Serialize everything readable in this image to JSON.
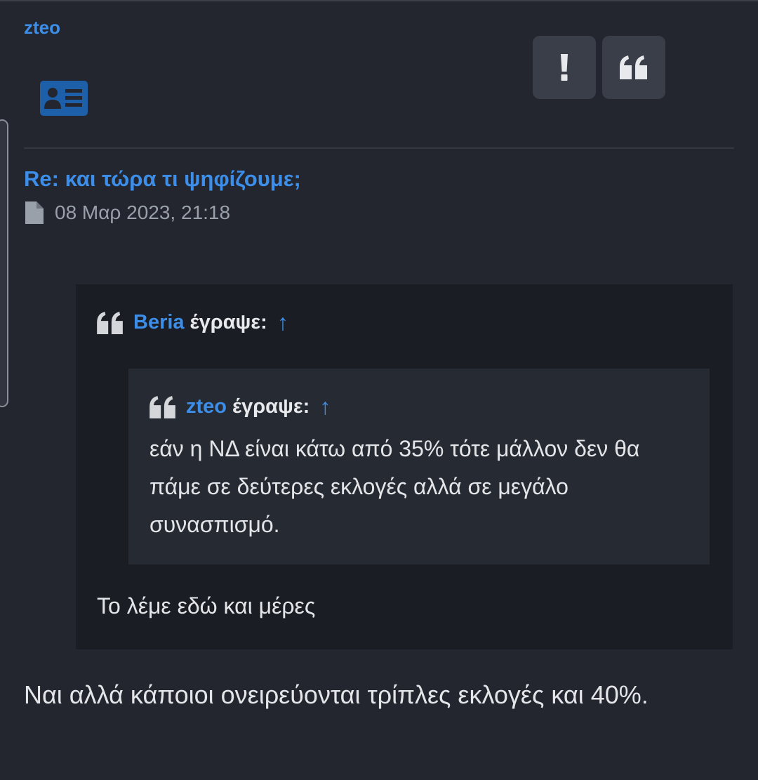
{
  "post": {
    "author": "zteo",
    "title": "Re: και τώρα τι ψηφίζουμε;",
    "date": "08 Μαρ 2023, 21:18",
    "body": "Ναι αλλά κάποιοι ονειρεύονται τρίπλες εκλογές και 40%."
  },
  "actions": {
    "report_label": "!",
    "quote_label": "❝"
  },
  "icons": {
    "profile": "profile-card-icon",
    "report": "exclamation-icon",
    "quote": "quote-icon",
    "post": "file-icon",
    "up": "up-arrow-icon"
  },
  "quote_outer": {
    "author": "Beria",
    "wrote": "έγραψε:",
    "arrow": "↑",
    "text": "Το λέμε εδώ και μέρες"
  },
  "quote_inner": {
    "author": "zteo",
    "wrote": "έγραψε:",
    "arrow": "↑",
    "text": "εάν η ΝΔ είναι κάτω από 35% τότε μάλλον δεν θα πάμε σε δεύτερες εκλογές αλλά σε μεγάλο συνασπισμό."
  },
  "colors": {
    "background": "#23262f",
    "accent": "#3d8ee8",
    "quote_bg": "#1b1d24",
    "nested_quote_bg": "#262a33",
    "button_bg": "#3a3e48"
  }
}
